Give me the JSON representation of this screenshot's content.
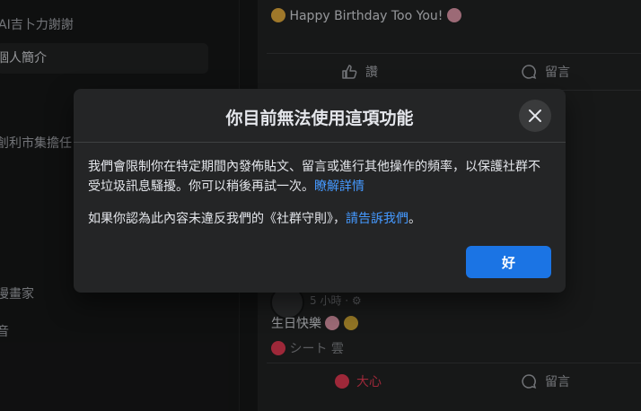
{
  "left_sidebar": {
    "items": [
      {
        "label": "AI吉卜力謝謝",
        "active": false
      },
      {
        "label": "個人簡介",
        "active": true
      },
      {
        "label": "創利市集擔任",
        "active": false
      },
      {
        "label": "漫畫家",
        "active": false
      },
      {
        "label": "音",
        "active": false
      }
    ]
  },
  "feed": {
    "post1": {
      "text": "Happy Birthday Too You!",
      "like_label": "讚",
      "comment_label": "留言"
    },
    "post2": {
      "time": "5 小時",
      "text": "生日快樂",
      "reactor": "シート 雲",
      "love_label": "大心",
      "comment_label": "留言"
    }
  },
  "dialog": {
    "title": "你目前無法使用這項功能",
    "body_line1": "我們會限制你在特定期間內發佈貼文、留言或進行其他操作的頻率，以保護社群不受垃圾訊息騷擾。你可以稍後再試一次。",
    "learn_more": "瞭解詳情",
    "body_line2": "如果你認為此內容未違反我們的《社群守則》，",
    "report_link": "請告訴我們",
    "body_line2_end": "。",
    "ok_label": "好"
  },
  "colors": {
    "accent": "#1b74e4",
    "link": "#4599ff",
    "dialog_bg": "#242526",
    "page_bg": "#18191a"
  }
}
